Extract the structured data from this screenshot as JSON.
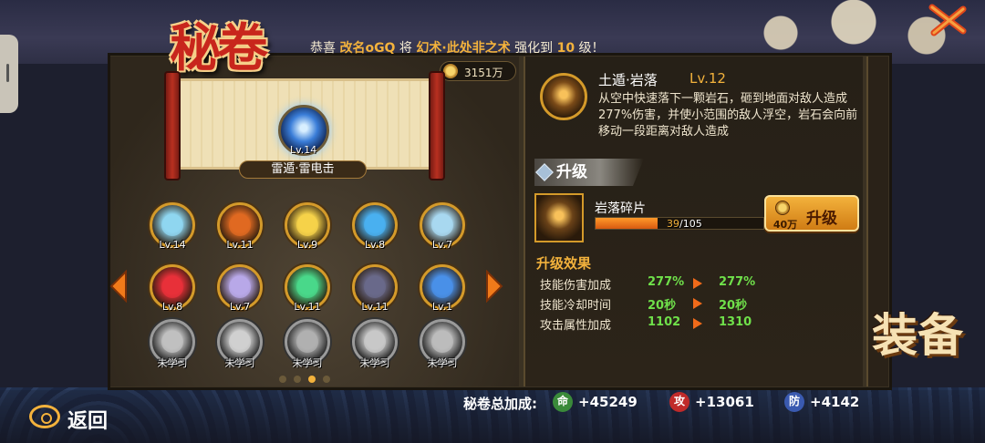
{
  "title": {
    "main": "秘卷"
  },
  "ticker": {
    "prefix": "恭喜",
    "player": "改名oGQ",
    "mid": "将",
    "skill": "幻术·此处非之术",
    "suffix": "强化到",
    "level": "10",
    "unit": "级！"
  },
  "currency": {
    "amount": "3151万"
  },
  "scroll": {
    "level": "Lv.14",
    "name": "雷遁·雷电击"
  },
  "skills": [
    {
      "label": "Lv.14",
      "color": "#8fd6f0",
      "locked": false
    },
    {
      "label": "Lv.11",
      "color": "#e06a22",
      "locked": false
    },
    {
      "label": "Lv.9",
      "color": "#f5d24a",
      "locked": false
    },
    {
      "label": "Lv.8",
      "color": "#4ab0f0",
      "locked": false
    },
    {
      "label": "Lv.7",
      "color": "#a8d8f0",
      "locked": false
    },
    {
      "label": "Lv.8",
      "color": "#e8303a",
      "locked": false
    },
    {
      "label": "Lv.7",
      "color": "#b8a8e8",
      "locked": false
    },
    {
      "label": "Lv.11",
      "color": "#4ad88a",
      "locked": false
    },
    {
      "label": "Lv.11",
      "color": "#6a6a8a",
      "locked": false
    },
    {
      "label": "Lv.1",
      "color": "#4a90e8",
      "locked": false
    },
    {
      "label": "未学习",
      "color": "#c0c0c0",
      "locked": true
    },
    {
      "label": "未学习",
      "color": "#d0d0d0",
      "locked": true
    },
    {
      "label": "未学习",
      "color": "#b0b0b0",
      "locked": true
    },
    {
      "label": "未学习",
      "color": "#c8c8c8",
      "locked": true
    },
    {
      "label": "未学习",
      "color": "#bcbcbc",
      "locked": true
    }
  ],
  "detail": {
    "name": "土遁·岩落",
    "level": "Lv.12",
    "desc": "从空中快速落下一颗岩石，砸到地面对敌人造成277%伤害，并使小范围的敌人浮空，岩石会向前移动一段距离对敌人造成"
  },
  "upgrade_section": {
    "header": "升级",
    "item_name": "岩落碎片",
    "progress_current": "39",
    "progress_total": "/105",
    "progress_fraction": 0.371,
    "cost": "40万",
    "button_label": "升级"
  },
  "effects": {
    "title": "升级效果",
    "rows": [
      {
        "key": "技能伤害加成",
        "from": "277%",
        "to": "277%"
      },
      {
        "key": "技能冷却时间",
        "from": "20秒",
        "to": "20秒"
      },
      {
        "key": "攻击属性加成",
        "from": "1102",
        "to": "1310"
      }
    ]
  },
  "equip_label": "装备",
  "bottom": {
    "back_label": "返回",
    "total_label": "秘卷总加成:",
    "stats": [
      {
        "badge": "命",
        "value": "+45249",
        "color": "#3a8a3a"
      },
      {
        "badge": "攻",
        "value": "+13061",
        "color": "#c02a2a"
      },
      {
        "badge": "防",
        "value": "+4142",
        "color": "#3a5ab0"
      }
    ]
  }
}
